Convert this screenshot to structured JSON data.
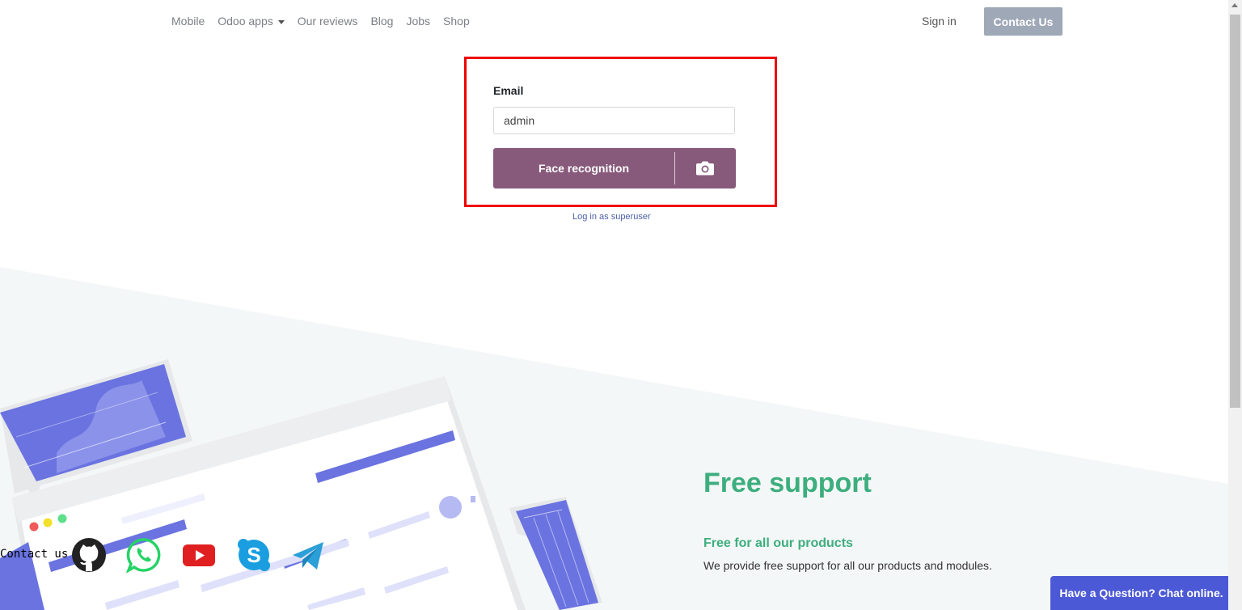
{
  "nav": {
    "links": [
      "Mobile",
      "Odoo apps",
      "Our reviews",
      "Blog",
      "Jobs",
      "Shop"
    ],
    "sign_in": "Sign in",
    "contact_button": "Contact Us"
  },
  "login": {
    "email_label": "Email",
    "email_value": "admin",
    "face_button": "Face recognition",
    "superuser_link": "Log in as superuser"
  },
  "support": {
    "title": "Free support",
    "subtitle": "Free for all our products",
    "description": "We provide free support for all our products and modules."
  },
  "social": {
    "label": "Contact us",
    "icons": [
      "github-icon",
      "whatsapp-icon",
      "youtube-icon",
      "skype-icon",
      "telegram-icon"
    ]
  },
  "chat": {
    "label": "Have a Question? Chat online."
  },
  "colors": {
    "odoo_purple": "#875a7b",
    "support_green": "#3dae7e",
    "illustration_blue": "#6a73e0",
    "highlight_red": "#ee0000",
    "chat_blue": "#4c59d6"
  }
}
